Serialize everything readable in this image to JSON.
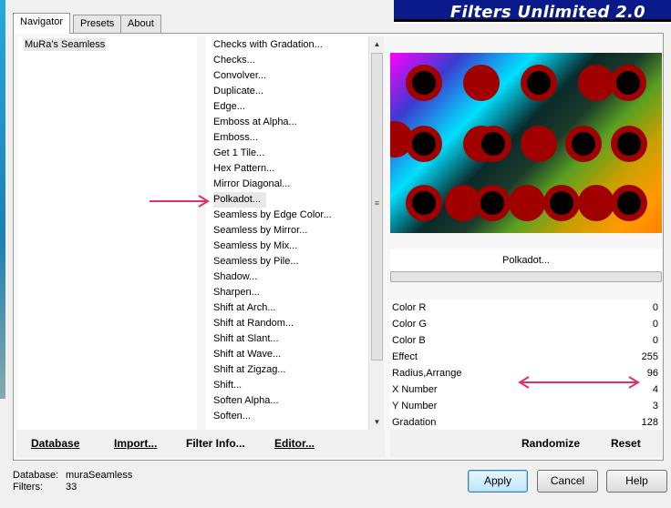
{
  "tabs": [
    "Navigator",
    "Presets",
    "About"
  ],
  "header_title": "Filters Unlimited 2.0",
  "categories": [
    "MuRa's Seamless"
  ],
  "filters": [
    "Checks with Gradation...",
    "Checks...",
    "Convolver...",
    "Duplicate...",
    "Edge...",
    "Emboss at Alpha...",
    "Emboss...",
    "Get 1 Tile...",
    "Hex Pattern...",
    "Mirror Diagonal...",
    "Polkadot...",
    "Seamless by Edge Color...",
    "Seamless by Mirror...",
    "Seamless by Mix...",
    "Seamless by Pile...",
    "Shadow...",
    "Sharpen...",
    "Shift at Arch...",
    "Shift at Random...",
    "Shift at Slant...",
    "Shift at Wave...",
    "Shift at Zigzag...",
    "Shift...",
    "Soften Alpha...",
    "Soften..."
  ],
  "selected_filter": "Polkadot...",
  "params": [
    {
      "label": "Color R",
      "value": "0"
    },
    {
      "label": "Color G",
      "value": "0"
    },
    {
      "label": "Color B",
      "value": "0"
    },
    {
      "label": "Effect",
      "value": "255"
    },
    {
      "label": "Radius,Arrange",
      "value": "96"
    },
    {
      "label": "X Number",
      "value": "4"
    },
    {
      "label": "Y Number",
      "value": "3"
    },
    {
      "label": "Gradation",
      "value": "128"
    }
  ],
  "left_buttons": [
    "Database",
    "Import...",
    "Filter Info...",
    "Editor..."
  ],
  "right_buttons": [
    "Randomize",
    "Reset"
  ],
  "status": {
    "database_label": "Database:",
    "database_value": "muraSeamless",
    "filters_label": "Filters:",
    "filters_value": "33"
  },
  "dialog_buttons": [
    "Apply",
    "Cancel",
    "Help"
  ],
  "colors": {
    "annotation_arrow": "#e0306a",
    "dot": "#a00000",
    "banner": "#0a1a8a"
  }
}
